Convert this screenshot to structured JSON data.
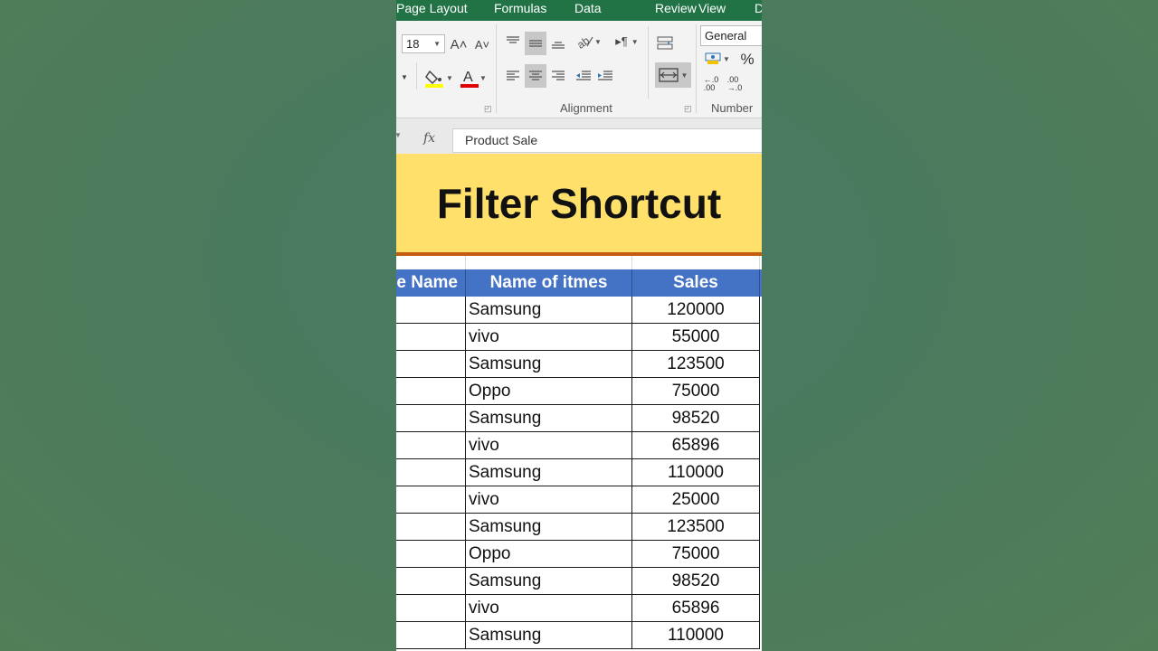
{
  "tabs": [
    "Page Layout",
    "Formulas",
    "Data",
    "Review",
    "View",
    "D"
  ],
  "ribbon": {
    "font_size": "18",
    "number_format": "General",
    "groups": {
      "alignment": "Alignment",
      "number": "Number"
    },
    "icons": {
      "grow_font": "A˄",
      "shrink_font": "A˅",
      "percent": "%",
      "increase_decimal": "←.0 .00",
      "decrease_decimal": ".00 →.0"
    }
  },
  "formula_bar": {
    "fx": "fx",
    "value": "Product Sale"
  },
  "banner": {
    "title": "Filter Shortcut"
  },
  "table": {
    "headers": [
      "e Name",
      "Name of itmes",
      "Sales"
    ],
    "rows": [
      {
        "item": "Samsung",
        "sales": "120000"
      },
      {
        "item": "vivo",
        "sales": "55000"
      },
      {
        "item": "Samsung",
        "sales": "123500"
      },
      {
        "item": "Oppo",
        "sales": "75000"
      },
      {
        "item": "Samsung",
        "sales": "98520"
      },
      {
        "item": "vivo",
        "sales": "65896"
      },
      {
        "item": "Samsung",
        "sales": "110000"
      },
      {
        "item": "vivo",
        "sales": "25000"
      },
      {
        "item": "Samsung",
        "sales": "123500"
      },
      {
        "item": "Oppo",
        "sales": "75000"
      },
      {
        "item": "Samsung",
        "sales": "98520"
      },
      {
        "item": "vivo",
        "sales": "65896"
      },
      {
        "item": "Samsung",
        "sales": "110000"
      }
    ]
  },
  "colors": {
    "ribbon_tab_bg": "#217346",
    "header_bg": "#4472c4",
    "banner_bg": "#fee06b",
    "banner_rule": "#c55a11",
    "font_color_red": "#e00000",
    "highlight_yellow": "#ffff00"
  }
}
